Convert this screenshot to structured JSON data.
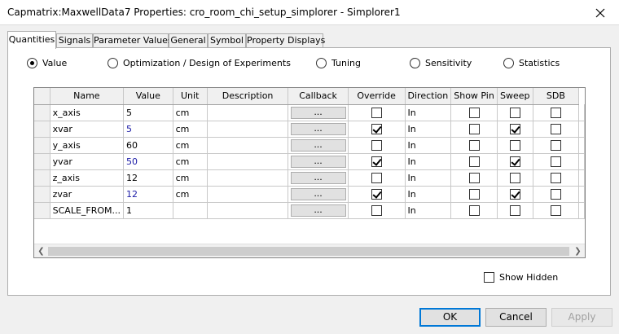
{
  "window": {
    "title": "Capmatrix:MaxwellData7 Properties: cro_room_chi_setup_simplorer - Simplorer1"
  },
  "tabs": [
    {
      "label": "Quantities",
      "active": true
    },
    {
      "label": "Signals"
    },
    {
      "label": "Parameter Values"
    },
    {
      "label": "General"
    },
    {
      "label": "Symbol"
    },
    {
      "label": "Property Displays"
    }
  ],
  "modes": [
    {
      "label": "Value",
      "selected": true
    },
    {
      "label": "Optimization / Design of Experiments",
      "selected": false
    },
    {
      "label": "Tuning",
      "selected": false
    },
    {
      "label": "Sensitivity",
      "selected": false
    },
    {
      "label": "Statistics",
      "selected": false
    }
  ],
  "grid": {
    "columns": [
      "Name",
      "Value",
      "Unit",
      "Description",
      "Callback",
      "Override",
      "Direction",
      "Show Pin",
      "Sweep",
      "SDB"
    ],
    "callback_label": "...",
    "rows": [
      {
        "name": "x_axis",
        "value": "5",
        "value_color": "black",
        "unit": "cm",
        "description": "",
        "override": false,
        "direction": "In",
        "show_pin": false,
        "sweep": false,
        "sdb": false
      },
      {
        "name": "xvar",
        "value": "5",
        "value_color": "blue",
        "unit": "cm",
        "description": "",
        "override": true,
        "direction": "In",
        "show_pin": false,
        "sweep": true,
        "sdb": false
      },
      {
        "name": "y_axis",
        "value": "60",
        "value_color": "black",
        "unit": "cm",
        "description": "",
        "override": false,
        "direction": "In",
        "show_pin": false,
        "sweep": false,
        "sdb": false
      },
      {
        "name": "yvar",
        "value": "50",
        "value_color": "blue",
        "unit": "cm",
        "description": "",
        "override": true,
        "direction": "In",
        "show_pin": false,
        "sweep": true,
        "sdb": false
      },
      {
        "name": "z_axis",
        "value": "12",
        "value_color": "black",
        "unit": "cm",
        "description": "",
        "override": false,
        "direction": "In",
        "show_pin": false,
        "sweep": false,
        "sdb": false
      },
      {
        "name": "zvar",
        "value": "12",
        "value_color": "blue",
        "unit": "cm",
        "description": "",
        "override": true,
        "direction": "In",
        "show_pin": false,
        "sweep": true,
        "sdb": false
      },
      {
        "name": "SCALE_FROM...",
        "value": "1",
        "value_color": "black",
        "unit": "",
        "description": "",
        "override": false,
        "direction": "In",
        "show_pin": false,
        "sweep": false,
        "sdb": false
      }
    ]
  },
  "show_hidden": {
    "label": "Show Hidden",
    "checked": false
  },
  "buttons": {
    "ok": "OK",
    "cancel": "Cancel",
    "apply": "Apply"
  },
  "colors": {
    "value_blue": "#1a1aa6",
    "default_button_border": "#0078d7"
  }
}
